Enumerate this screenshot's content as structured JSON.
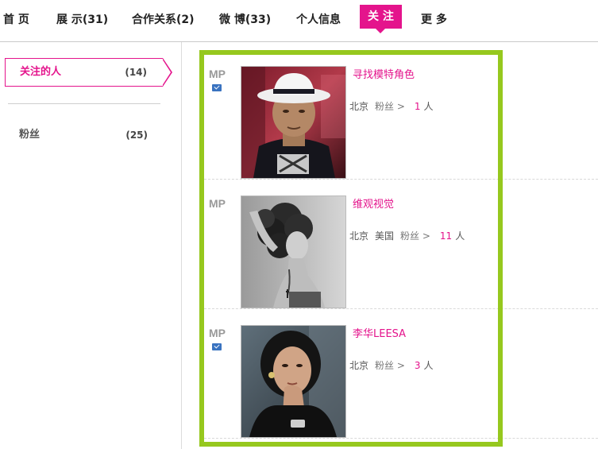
{
  "nav": {
    "items": [
      {
        "label": "首 页"
      },
      {
        "label": "展 示(31)"
      },
      {
        "label": "合作关系(2)"
      },
      {
        "label": "微 博(33)"
      },
      {
        "label": "个人信息"
      },
      {
        "label": "关 注"
      },
      {
        "label": "更 多"
      }
    ],
    "active_color": "#e4148c"
  },
  "sidebar": {
    "items": [
      {
        "label": "关注的人",
        "count": "(14)"
      },
      {
        "label": "粉丝",
        "count": "(25)"
      }
    ]
  },
  "highlight_color": "#96c81e",
  "people": [
    {
      "badge": "MP",
      "verified": true,
      "name": "寻找模特角色",
      "location": "北京",
      "region": "",
      "fans_label": "粉丝 >",
      "fans_count": "1",
      "fans_unit": "人"
    },
    {
      "badge": "MP",
      "verified": false,
      "name": "维观视觉",
      "location": "北京",
      "region": "美国",
      "fans_label": "粉丝 >",
      "fans_count": "11",
      "fans_unit": "人"
    },
    {
      "badge": "MP",
      "verified": true,
      "name": "李华LEESA",
      "location": "北京",
      "region": "",
      "fans_label": "粉丝 >",
      "fans_count": "3",
      "fans_unit": "人"
    }
  ]
}
